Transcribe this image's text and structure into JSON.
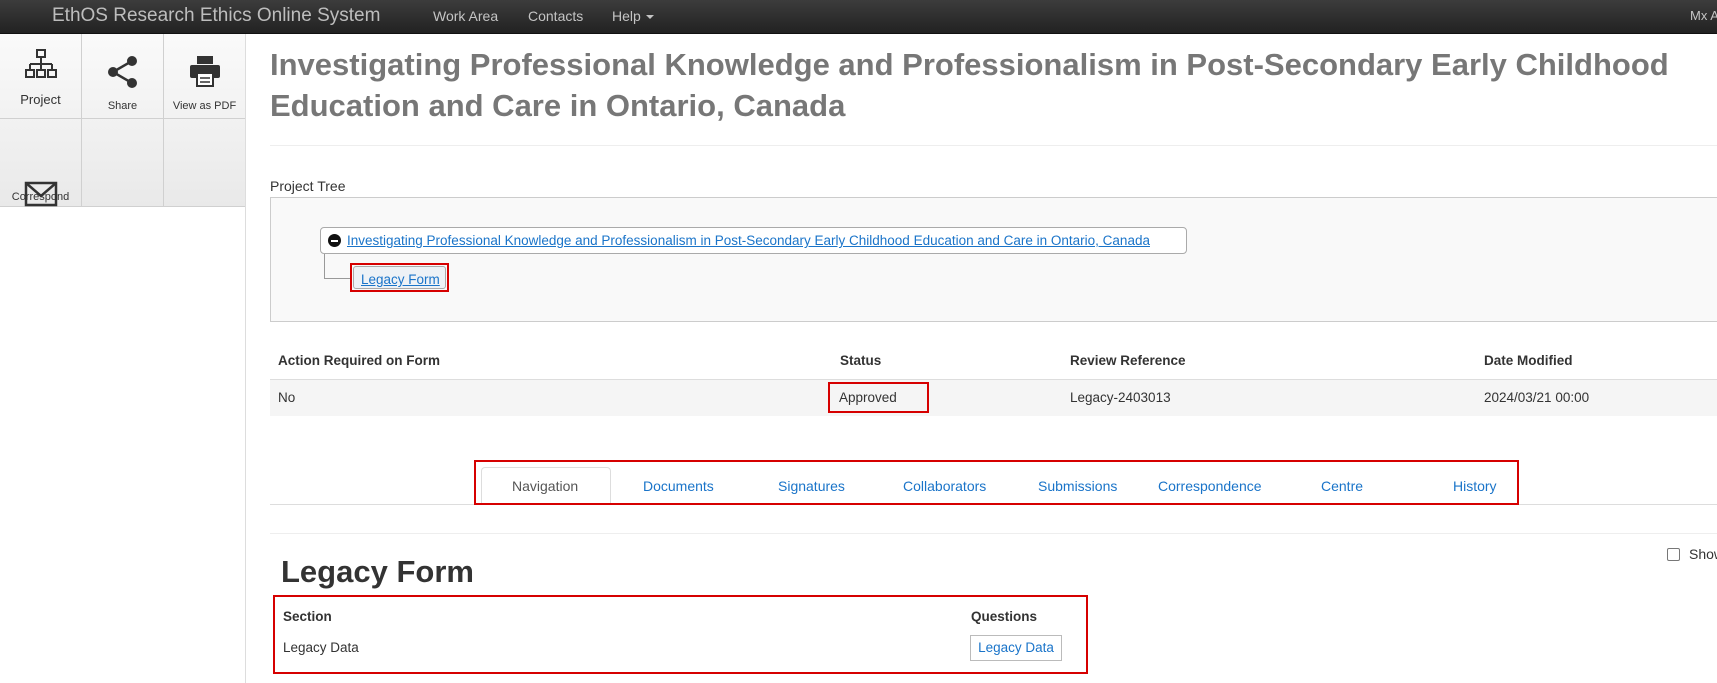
{
  "navbar": {
    "brand": "EthOS Research Ethics Online System",
    "links": [
      "Work Area",
      "Contacts",
      "Help"
    ],
    "user": "Mx A"
  },
  "toolbar": {
    "project": "Project",
    "share": "Share",
    "pdf": "View as PDF",
    "correspond": "Correspond"
  },
  "page": {
    "title": "Investigating Professional Knowledge and Professionalism in Post-Secondary Early Childhood Education and Care in Ontario, Canada"
  },
  "tree": {
    "label": "Project Tree",
    "root": "Investigating Professional Knowledge and Professionalism in Post-Secondary Early Childhood Education and Care in Ontario, Canada",
    "child": "Legacy Form"
  },
  "summary": {
    "headers": [
      "Action Required on Form",
      "Status",
      "Review Reference",
      "Date Modified"
    ],
    "row": [
      "No",
      "Approved",
      "Legacy-2403013",
      "2024/03/21 00:00"
    ]
  },
  "tabs": [
    "Navigation",
    "Documents",
    "Signatures",
    "Collaborators",
    "Submissions",
    "Correspondence",
    "Centre",
    "History"
  ],
  "form": {
    "show_label": "Show",
    "title": "Legacy Form",
    "headers": [
      "Section",
      "Questions"
    ],
    "section": "Legacy Data",
    "question_button": "Legacy Data"
  }
}
